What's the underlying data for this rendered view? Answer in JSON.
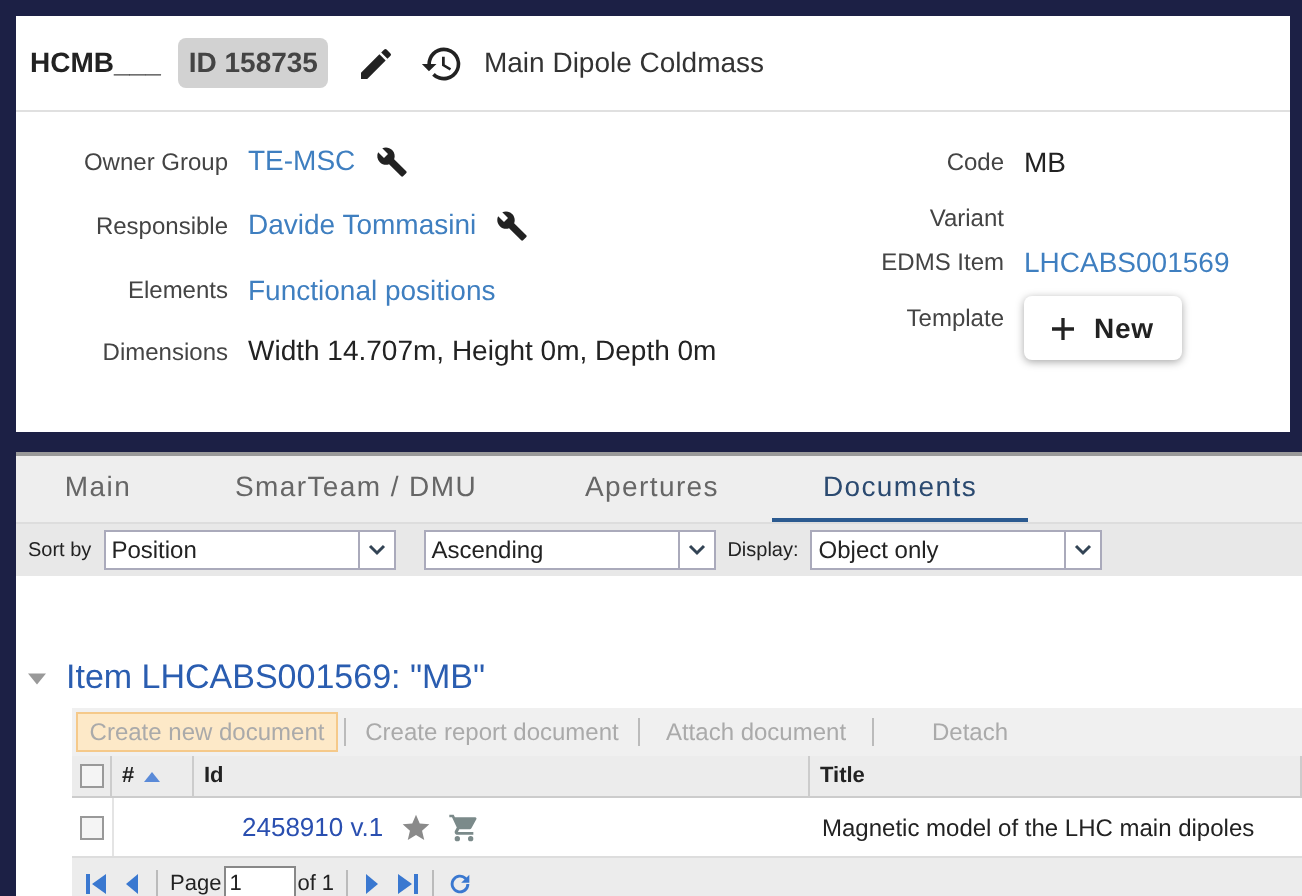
{
  "header": {
    "code": "HCMB___",
    "id_badge": "ID 158735",
    "title": "Main Dipole Coldmass"
  },
  "fields_left": [
    {
      "label": "Owner Group",
      "value": "TE-MSC",
      "kind": "link",
      "wrench": true
    },
    {
      "label": "Responsible",
      "value": "Davide Tommasini",
      "kind": "link",
      "wrench": true
    },
    {
      "label": "Elements",
      "value": "Functional positions",
      "kind": "link",
      "wrench": false
    },
    {
      "label": "Dimensions",
      "value": "Width 14.707m, Height 0m, Depth 0m",
      "kind": "text",
      "wrench": false
    }
  ],
  "fields_right": [
    {
      "label": "Code",
      "value": "MB",
      "kind": "text"
    },
    {
      "label": "Variant",
      "kind": "empty"
    },
    {
      "label": "EDMS Item",
      "value": "LHCABS001569",
      "kind": "link"
    },
    {
      "label": "Template",
      "button": "New",
      "kind": "button"
    }
  ],
  "tabs": [
    {
      "label": "Main",
      "selected": false
    },
    {
      "label": "SmarTeam / DMU",
      "selected": false
    },
    {
      "label": "Apertures",
      "selected": false
    },
    {
      "label": "Documents",
      "selected": true
    }
  ],
  "sort_bar": {
    "sort_label": "Sort by",
    "sort_value": "Position",
    "order_value": "Ascending",
    "display_label": "Display:",
    "display_value": "Object only"
  },
  "item": {
    "title": "Item LHCABS001569: \"MB\"",
    "expanded": true
  },
  "toolbar": [
    {
      "label": "Create new document",
      "highlighted": true
    },
    {
      "label": "Create report document",
      "highlighted": false
    },
    {
      "label": "Attach document",
      "highlighted": false
    },
    {
      "label": "Detach",
      "highlighted": false
    }
  ],
  "table": {
    "columns": [
      {
        "label": "#",
        "sorted": true
      },
      {
        "label": "Id",
        "sorted": false
      },
      {
        "label": "Title",
        "sorted": false
      }
    ],
    "all_checked": false,
    "rows": [
      {
        "checked": false,
        "id": "2458910 v.1",
        "title": "Magnetic model of the LHC main dipoles"
      }
    ]
  },
  "pager": {
    "page_label": "Page",
    "page_value": "1",
    "of_label": "of 1"
  }
}
